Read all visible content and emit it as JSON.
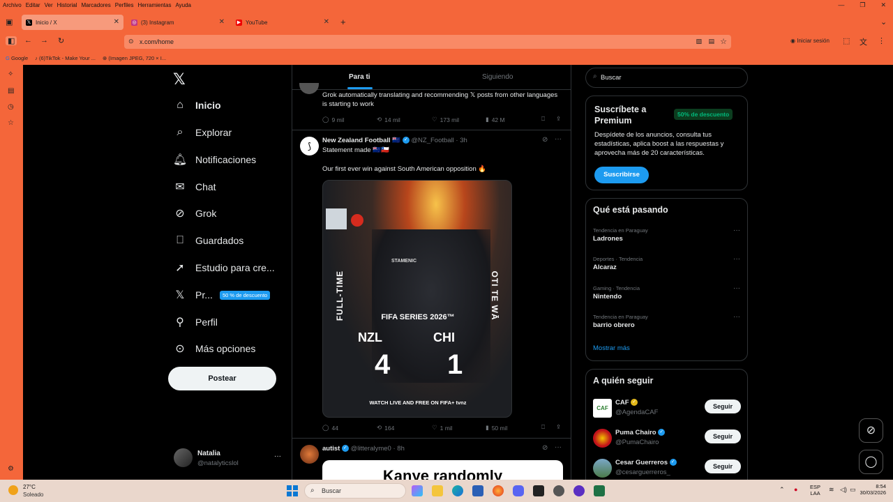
{
  "browser": {
    "menu": [
      "Archivo",
      "Editar",
      "Ver",
      "Historial",
      "Marcadores",
      "Perfiles",
      "Herramientas",
      "Ayuda"
    ],
    "tabs": [
      {
        "title": "Inicio / X",
        "active": true
      },
      {
        "title": "(3) Instagram",
        "active": false
      },
      {
        "title": "YouTube",
        "active": false
      }
    ],
    "url": "x.com/home",
    "signin": "Iniciar sesión",
    "bookmarks": [
      "Google",
      "(6)TikTok - Make Your ...",
      "(Imagen JPEG, 720 × I..."
    ]
  },
  "leftnav": {
    "items": [
      {
        "label": "Inicio",
        "icon": "home-icon"
      },
      {
        "label": "Explorar",
        "icon": "search-icon"
      },
      {
        "label": "Notificaciones",
        "icon": "bell-icon"
      },
      {
        "label": "Chat",
        "icon": "mail-icon"
      },
      {
        "label": "Grok",
        "icon": "grok-icon"
      },
      {
        "label": "Guardados",
        "icon": "bookmark-icon"
      },
      {
        "label": "Estudio para cre...",
        "icon": "rocket-icon"
      },
      {
        "label": "Pr...",
        "icon": "x-logo-icon"
      },
      {
        "label": "Perfil",
        "icon": "person-icon"
      },
      {
        "label": "Más opciones",
        "icon": "more-circle-icon"
      }
    ],
    "premium_badge": "50 % de descuento",
    "post_button": "Postear",
    "user": {
      "name": "Natalia",
      "handle": "@natalyticslol"
    }
  },
  "timeline": {
    "tabs": [
      "Para ti",
      "Siguiendo"
    ],
    "post0": {
      "text": "Grok automatically translating and recommending 𝕏 posts from other languages is starting to work",
      "replies": "9 mil",
      "reposts": "14 mil",
      "likes": "173 mil",
      "views": "42 M"
    },
    "post1": {
      "name": "New Zealand Football 🇳🇿",
      "handle": "@NZ_Football · 3h",
      "line1": "Statement made 🇳🇿🇨🇱",
      "line2": "Our first ever win against South American opposition 🔥",
      "image": {
        "left": "FULL-TIME",
        "right": "OTI TE WĀ",
        "series": "FIFA SERIES 2026™",
        "team1": "NZL",
        "team2": "CHI",
        "score1": "4",
        "score2": "1",
        "footer": "WATCH LIVE AND FREE ON FIFA+ tvnz",
        "player": "STAMENIC"
      },
      "replies": "44",
      "reposts": "164",
      "likes": "1 mil",
      "views": "50 mil"
    },
    "post2": {
      "name": "autist",
      "handle": "@litteralyme0 · 8h",
      "image_text": "Kanye randomly"
    }
  },
  "right": {
    "search_placeholder": "Buscar",
    "premium": {
      "title": "Suscríbete a Premium",
      "badge": "50% de descuento",
      "desc": "Despídete de los anuncios, consulta tus estadísticas, aplica boost a las respuestas y aprovecha más de 20 características.",
      "button": "Suscribirse"
    },
    "trends": {
      "title": "Qué está pasando",
      "items": [
        {
          "category": "Tendencia en Paraguay",
          "name": "Ladrones"
        },
        {
          "category": "Deportes · Tendencia",
          "name": "Alcaraz"
        },
        {
          "category": "Gaming · Tendencia",
          "name": "Nintendo"
        },
        {
          "category": "Tendencia en Paraguay",
          "name": "barrio obrero"
        }
      ],
      "more": "Mostrar más"
    },
    "follow": {
      "title": "A quién seguir",
      "items": [
        {
          "name": "CAF",
          "handle": "@AgendaCAF",
          "button": "Seguir"
        },
        {
          "name": "Puma Chairo",
          "handle": "@PumaChairo",
          "button": "Seguir"
        },
        {
          "name": "Cesar Guerreros",
          "handle": "@cesarguerreros_",
          "button": "Seguir"
        }
      ]
    }
  },
  "taskbar": {
    "weather_temp": "27°C",
    "weather_desc": "Soleado",
    "search": "Buscar",
    "lang": "ESP",
    "lang2": "LAA",
    "time": "8:54",
    "date": "30/03/2026"
  },
  "colors": {
    "browser": "#f4663a",
    "accent": "#1d9bf0",
    "bg": "#000000"
  }
}
